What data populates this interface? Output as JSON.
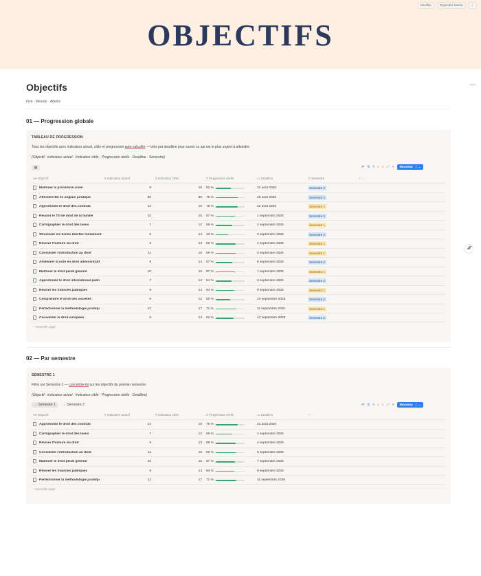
{
  "top_actions": [
    "Modifier",
    "Rejoindre Notion",
    "⋮"
  ],
  "banner": {
    "title": "OBJECTIFS"
  },
  "page": {
    "title": "Objectifs",
    "subtitle": "Fixe · Mesure · Atteins",
    "collapse_icon": "—",
    "float_icon": "𝓕"
  },
  "section1": {
    "heading": "01 — Progression globale",
    "label": "TABLEAU DE PROGRESSION",
    "desc_a": "Tous tes objectifs avec indicateur actuel, cible et progression ",
    "desc_ul": "auto-calculée",
    "desc_b": " — triés par deadline pour savoir ce qui est le plus urgent à atteindre.",
    "props": "(Objectif · indicateur actuel · Indicateur cible · Progression réelle · Deadline · Semestre)",
    "view_icon": "▦",
    "new_button": "Nouveau",
    "new_page": "+  Nouvelle page",
    "columns": [
      "Aa  Objectif",
      "#  Indicateur actuel",
      "#  Indicateur cible",
      "Σ  Progression réelle",
      "▭  Deadline",
      "⊙  Semestre",
      "+  ···"
    ],
    "rows": [
      {
        "name": "Maîtriser la procédure civile",
        "actual": "8",
        "target": "16",
        "pct": "52 %",
        "p": 0.52,
        "deadline": "31 août 2026",
        "semestre": "Semestre 2",
        "s": 2
      },
      {
        "name": "Atteindre B2 en anglais juridique",
        "actual": "60",
        "target": "80",
        "pct": "75 %",
        "p": 0.75,
        "deadline": "28 août 2026",
        "semestre": "Semestre 2",
        "s": 2
      },
      {
        "name": "Approfondir le droit des contrats",
        "actual": "12",
        "target": "16",
        "pct": "75 %",
        "p": 0.75,
        "deadline": "31 août 2026",
        "semestre": "Semestre 1",
        "s": 1
      },
      {
        "name": "Réussir le TD de droit de la famille",
        "actual": "10",
        "target": "15",
        "pct": "67 %",
        "p": 0.67,
        "deadline": "1 septembre 2026",
        "semestre": "Semestre 2",
        "s": 2
      },
      {
        "name": "Cartographier le droit des biens",
        "actual": "7",
        "target": "12",
        "pct": "58 %",
        "p": 0.58,
        "deadline": "2 septembre 2026",
        "semestre": "Semestre 1",
        "s": 1
      },
      {
        "name": "Structurer les fiches libertés fondament",
        "actual": "6",
        "target": "14",
        "pct": "43 %",
        "p": 0.43,
        "deadline": "3 septembre 2026",
        "semestre": "Semestre 2",
        "s": 2
      },
      {
        "name": "Réviser l'histoire du droit",
        "actual": "9",
        "target": "13",
        "pct": "69 %",
        "p": 0.69,
        "deadline": "4 septembre 2026",
        "semestre": "Semestre 1",
        "s": 1
      },
      {
        "name": "Consolider l'introduction au droit",
        "actual": "11",
        "target": "16",
        "pct": "69 %",
        "p": 0.69,
        "deadline": "5 septembre 2026",
        "semestre": "Semestre 1",
        "s": 1
      },
      {
        "name": "Améliorer la note en droit administratif",
        "actual": "8",
        "target": "14",
        "pct": "57 %",
        "p": 0.57,
        "deadline": "6 septembre 2026",
        "semestre": "Semestre 2",
        "s": 2
      },
      {
        "name": "Maîtriser le droit pénal général",
        "actual": "10",
        "target": "15",
        "pct": "67 %",
        "p": 0.67,
        "deadline": "7 septembre 2026",
        "semestre": "Semestre 1",
        "s": 1
      },
      {
        "name": "Approfondir le droit international publi",
        "actual": "7",
        "target": "13",
        "pct": "54 %",
        "p": 0.54,
        "deadline": "8 septembre 2026",
        "semestre": "Semestre 2",
        "s": 2
      },
      {
        "name": "Réviser les finances publiques",
        "actual": "9",
        "target": "14",
        "pct": "64 %",
        "p": 0.64,
        "deadline": "9 septembre 2026",
        "semestre": "Semestre 1",
        "s": 1
      },
      {
        "name": "Comprendre le droit des sociétés",
        "actual": "6",
        "target": "12",
        "pct": "50 %",
        "p": 0.5,
        "deadline": "10 septembre 2026",
        "semestre": "Semestre 2",
        "s": 2
      },
      {
        "name": "Perfectionner la méthodologie juridiqu",
        "actual": "12",
        "target": "17",
        "pct": "71 %",
        "p": 0.71,
        "deadline": "11 septembre 2026",
        "semestre": "Semestre 1",
        "s": 1
      },
      {
        "name": "Consolider le droit européen",
        "actual": "8",
        "target": "13",
        "pct": "62 %",
        "p": 0.62,
        "deadline": "12 septembre 2026",
        "semestre": "Semestre 2",
        "s": 2
      }
    ]
  },
  "section2": {
    "heading": "02 — Par semestre",
    "label": "SEMESTRE 1",
    "desc_a": "Filtre sur Semestre 1 — ",
    "desc_ul": "concentre-toi",
    "desc_b": " sur les objectifs du premier semestre.",
    "props": "(Objectif · indicateur actuel · Indicateur cible · Progression réelle · Deadline)",
    "tabs": [
      "→  Semestre 1",
      "→  Semestre 2"
    ],
    "new_button": "Nouveau",
    "new_page": "+  Nouvelle page",
    "columns": [
      "Aa  Objectif",
      "#  Indicateur actuel",
      "#  Indicateur cible",
      "Σ  Progression réelle",
      "▭  Deadline",
      "+  ···"
    ],
    "rows": [
      {
        "name": "Approfondir le droit des contrats",
        "actual": "12",
        "target": "16",
        "pct": "75 %",
        "p": 0.75,
        "deadline": "31 août 2026"
      },
      {
        "name": "Cartographier le droit des biens",
        "actual": "7",
        "target": "12",
        "pct": "58 %",
        "p": 0.58,
        "deadline": "2 septembre 2026"
      },
      {
        "name": "Réviser l'histoire du droit",
        "actual": "9",
        "target": "13",
        "pct": "69 %",
        "p": 0.69,
        "deadline": "4 septembre 2026"
      },
      {
        "name": "Consolider l'introduction au droit",
        "actual": "11",
        "target": "16",
        "pct": "69 %",
        "p": 0.69,
        "deadline": "5 septembre 2026"
      },
      {
        "name": "Maîtriser le droit pénal général",
        "actual": "10",
        "target": "15",
        "pct": "67 %",
        "p": 0.67,
        "deadline": "7 septembre 2026"
      },
      {
        "name": "Réviser les finances publiques",
        "actual": "9",
        "target": "14",
        "pct": "64 %",
        "p": 0.64,
        "deadline": "9 septembre 2026"
      },
      {
        "name": "Perfectionner la méthodologie juridiqu",
        "actual": "12",
        "target": "17",
        "pct": "71 %",
        "p": 0.71,
        "deadline": "11 septembre 2026"
      }
    ]
  },
  "toolbar_icons": [
    "⇌",
    "⇅",
    "ϟ",
    "⌕",
    "⌕",
    "⤢",
    "≡"
  ],
  "colors": {
    "accent": "#2f80ed",
    "progress": "#3aa26a",
    "semestre1": "#fbe6b6",
    "semestre2": "#d6e6f7",
    "banner_bg": "#fdf0e3",
    "banner_title": "#2b3a5c"
  }
}
